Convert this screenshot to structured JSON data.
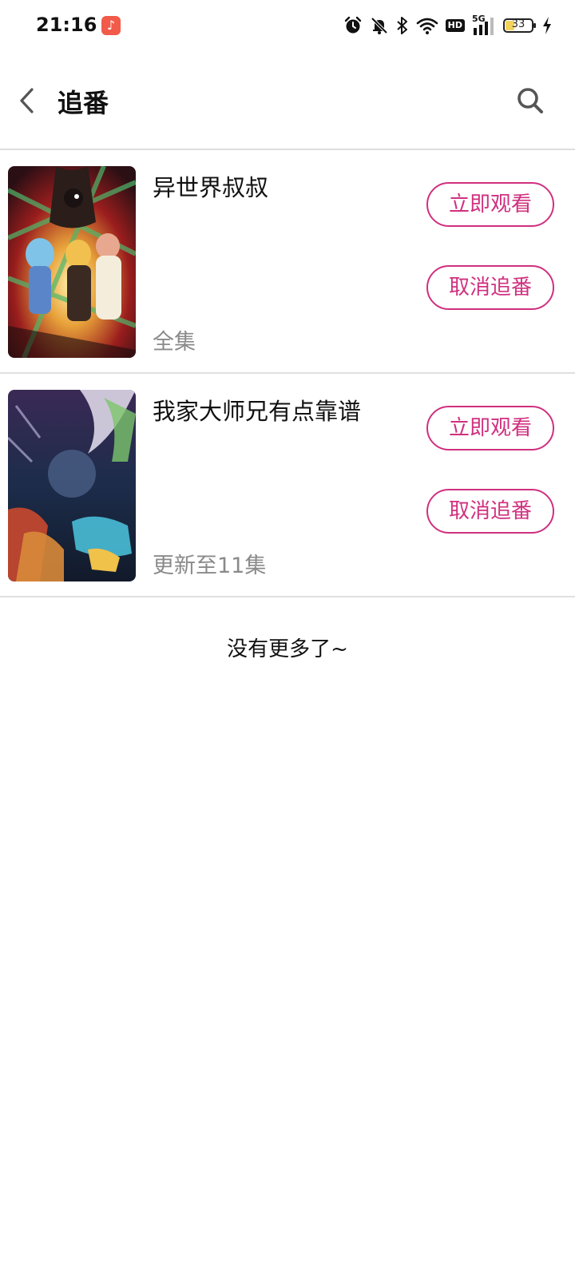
{
  "status_bar": {
    "time": "21:16",
    "app_badge_icon": "music-note-icon",
    "icons": [
      "alarm-icon",
      "bell-muted-icon",
      "bluetooth-icon",
      "wifi-icon",
      "hd-icon",
      "5g-signal-icon",
      "battery-icon",
      "charging-icon"
    ],
    "hd_label": "HD",
    "network_label": "5G",
    "battery_level": "33",
    "battery_fraction": 0.33,
    "battery_color": "#f3d35c"
  },
  "header": {
    "title": "追番",
    "back_icon": "chevron-left-icon",
    "search_icon": "search-icon"
  },
  "accent_color": "#d0307f",
  "items": [
    {
      "title": "异世界叔叔",
      "status": "全集",
      "watch_label": "立即观看",
      "unfollow_label": "取消追番"
    },
    {
      "title": "我家大师兄有点靠谱",
      "status": "更新至11集",
      "watch_label": "立即观看",
      "unfollow_label": "取消追番"
    }
  ],
  "footer_text": "没有更多了~"
}
